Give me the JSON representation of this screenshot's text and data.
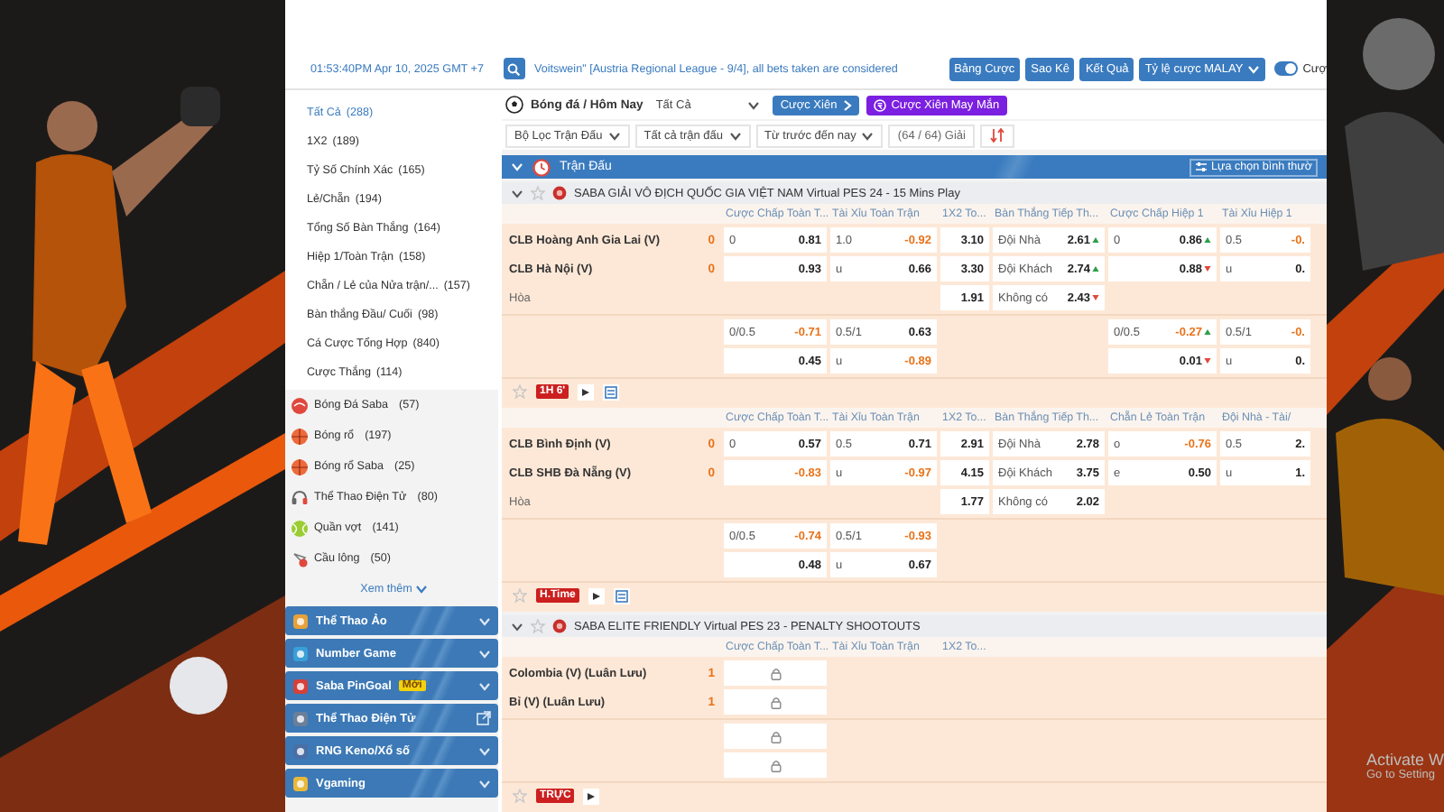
{
  "top_bar": {
    "clock": "01:53:40PM Apr 10, 2025 GMT +7",
    "notice": "Voitswein\" [Austria Regional League - 9/4], all bets taken are considered",
    "buttons": [
      "Bảng Cược",
      "Sao Kê",
      "Kết Quả"
    ],
    "odds_type": "Tỷ lệ cược MALAY",
    "toggle": {
      "label": "Cượ",
      "on": true
    }
  },
  "sidebar": {
    "bet_types": [
      {
        "label": "Tất Cả",
        "count": "(288)",
        "selected": true
      },
      {
        "label": "1X2",
        "count": "(189)",
        "selected": false
      },
      {
        "label": "Tỷ Số Chính Xác",
        "count": "(165)",
        "selected": false
      },
      {
        "label": "Lẻ/Chẵn",
        "count": "(194)",
        "selected": false
      },
      {
        "label": "Tổng Số Bàn Thắng",
        "count": "(164)",
        "selected": false
      },
      {
        "label": "Hiệp 1/Toàn Trận",
        "count": "(158)",
        "selected": false
      },
      {
        "label": "Chẵn / Lẻ của Nửa trận/...",
        "count": "(157)",
        "selected": false
      },
      {
        "label": "Bàn thắng Đầu/ Cuối",
        "count": "(98)",
        "selected": false
      },
      {
        "label": "Cá Cược Tổng Hợp",
        "count": "(840)",
        "selected": false
      },
      {
        "label": "Cược Thắng",
        "count": "(114)",
        "selected": false
      }
    ],
    "sports": [
      {
        "kind": "soccer",
        "label": "Bóng Đá Saba",
        "count": "(57)"
      },
      {
        "kind": "basketball",
        "label": "Bóng rổ",
        "count": "(197)"
      },
      {
        "kind": "basketball",
        "label": "Bóng rổ Saba",
        "count": "(25)"
      },
      {
        "kind": "esports",
        "label": "Thể Thao Điện Tử",
        "count": "(80)"
      },
      {
        "kind": "tennis",
        "label": "Quần vợt",
        "count": "(141)"
      },
      {
        "kind": "badminton",
        "label": "Cầu lông",
        "count": "(50)"
      }
    ],
    "more": "Xem thêm",
    "sections": [
      {
        "label": "Thể Thao Ảo",
        "kind": "expand"
      },
      {
        "label": "Number Game",
        "kind": "expand"
      },
      {
        "label": "Saba PinGoal",
        "badge": "Mới",
        "kind": "expand"
      },
      {
        "label": "Thể Thao Điện Tử",
        "kind": "link"
      },
      {
        "label": "RNG Keno/Xổ số",
        "kind": "expand"
      },
      {
        "label": "Vgaming",
        "kind": "expand"
      }
    ]
  },
  "toolbar": {
    "sport": "Bóng đá / Hôm Nay",
    "filter": "Tất Cả",
    "parlay": "Cược Xiên",
    "lucky_parlay": "Cược Xiên May Mắn"
  },
  "filters": [
    "Bộ Lọc Trận Đấu",
    "Tất cả trận đấu",
    "Từ trước đến nay"
  ],
  "league_count": "(64 / 64) Giải",
  "section": {
    "title": "Trận Đấu",
    "view": "Lựa chọn bình thườ",
    "expanded": true
  },
  "leagues": [
    {
      "name": "SABA GIẢI VÔ ĐỊCH QUỐC GIA VIỆT NAM Virtual PES 24 - 15 Mins Play",
      "expanded": true,
      "favorite": false,
      "matches": [
        {
          "columns": [
            "Cược Chấp Toàn T...",
            "Tài Xỉu Toàn Trận",
            "1X2 To...",
            "Bàn Thắng Tiếp Th...",
            "Cược Chấp Hiệp 1",
            "Tài Xỉu Hiệp 1"
          ],
          "main_rows": [
            {
              "kind": "team",
              "label": "CLB Hoàng Anh Gia Lai (V)",
              "score": "0",
              "cells": [
                {
                  "kind": "odds",
                  "line": "0",
                  "odds": "0.81",
                  "neg": false,
                  "up": false,
                  "down": false
                },
                {
                  "kind": "odds",
                  "line": "1.0",
                  "odds": "-0.92",
                  "neg": true,
                  "up": false,
                  "down": false
                },
                {
                  "kind": "odds",
                  "odds": "3.10",
                  "neg": false,
                  "up": false,
                  "down": false
                },
                {
                  "kind": "odds",
                  "line": "Đội Nhà",
                  "odds": "2.61",
                  "neg": false,
                  "up": true,
                  "down": false
                },
                {
                  "kind": "odds",
                  "line": "0",
                  "odds": "0.86",
                  "neg": false,
                  "up": true,
                  "down": false
                },
                {
                  "kind": "odds",
                  "line": "0.5",
                  "odds": "-0.",
                  "neg": true,
                  "up": false,
                  "down": false
                }
              ]
            },
            {
              "kind": "team",
              "label": "CLB Hà Nội (V)",
              "score": "0",
              "cells": [
                {
                  "kind": "odds",
                  "odds": "0.93",
                  "neg": false,
                  "up": false,
                  "down": false
                },
                {
                  "kind": "odds",
                  "line": "u",
                  "odds": "0.66",
                  "neg": false,
                  "up": false,
                  "down": false
                },
                {
                  "kind": "odds",
                  "odds": "3.30",
                  "neg": false,
                  "up": false,
                  "down": false
                },
                {
                  "kind": "odds",
                  "line": "Đội Khách",
                  "odds": "2.74",
                  "neg": false,
                  "up": true,
                  "down": false
                },
                {
                  "kind": "odds",
                  "odds": "0.88",
                  "neg": false,
                  "up": false,
                  "down": true
                },
                {
                  "kind": "odds",
                  "line": "u",
                  "odds": "0.",
                  "neg": false,
                  "up": false,
                  "down": false
                }
              ]
            },
            {
              "kind": "draw",
              "label": "Hòa",
              "cells": [
                null,
                null,
                {
                  "kind": "odds",
                  "odds": "1.91",
                  "neg": false,
                  "up": false,
                  "down": false
                },
                {
                  "kind": "odds",
                  "line": "Không có",
                  "odds": "2.43",
                  "neg": false,
                  "up": false,
                  "down": true
                },
                null,
                null
              ]
            }
          ],
          "extra_rows": [
            {
              "cells": [
                {
                  "kind": "odds",
                  "line": "0/0.5",
                  "odds": "-0.71",
                  "neg": true,
                  "up": false,
                  "down": false
                },
                {
                  "kind": "odds",
                  "line": "0.5/1",
                  "odds": "0.63",
                  "neg": false,
                  "up": false,
                  "down": false
                },
                null,
                null,
                {
                  "kind": "odds",
                  "line": "0/0.5",
                  "odds": "-0.27",
                  "neg": true,
                  "up": true,
                  "down": false
                },
                {
                  "kind": "odds",
                  "line": "0.5/1",
                  "odds": "-0.",
                  "neg": true,
                  "up": false,
                  "down": false
                }
              ]
            },
            {
              "cells": [
                {
                  "kind": "odds",
                  "odds": "0.45",
                  "neg": false,
                  "up": false,
                  "down": false
                },
                {
                  "kind": "odds",
                  "line": "u",
                  "odds": "-0.89",
                  "neg": true,
                  "up": false,
                  "down": false
                },
                null,
                null,
                {
                  "kind": "odds",
                  "odds": "0.01",
                  "neg": false,
                  "up": false,
                  "down": true
                },
                {
                  "kind": "odds",
                  "line": "u",
                  "odds": "0.",
                  "neg": false,
                  "up": false,
                  "down": false
                }
              ]
            }
          ],
          "footer": {
            "favorite": false,
            "badge": "1H 6'",
            "stats": true
          }
        },
        {
          "columns": [
            "Cược Chấp Toàn T...",
            "Tài Xỉu Toàn Trận",
            "1X2 To...",
            "Bàn Thắng Tiếp Th...",
            "Chẵn Lẻ Toàn Trận",
            "Đội Nhà - Tài/"
          ],
          "main_rows": [
            {
              "kind": "team",
              "label": "CLB Bình Định (V)",
              "score": "0",
              "cells": [
                {
                  "kind": "odds",
                  "line": "0",
                  "odds": "0.57",
                  "neg": false,
                  "up": false,
                  "down": false
                },
                {
                  "kind": "odds",
                  "line": "0.5",
                  "odds": "0.71",
                  "neg": false,
                  "up": false,
                  "down": false
                },
                {
                  "kind": "odds",
                  "odds": "2.91",
                  "neg": false,
                  "up": false,
                  "down": false
                },
                {
                  "kind": "odds",
                  "line": "Đội Nhà",
                  "odds": "2.78",
                  "neg": false,
                  "up": false,
                  "down": false
                },
                {
                  "kind": "odds",
                  "line": "o",
                  "odds": "-0.76",
                  "neg": true,
                  "up": false,
                  "down": false
                },
                {
                  "kind": "odds",
                  "line": "0.5",
                  "odds": "2.",
                  "neg": false,
                  "up": false,
                  "down": false
                }
              ]
            },
            {
              "kind": "team",
              "label": "CLB SHB Đà Nẵng (V)",
              "score": "0",
              "cells": [
                {
                  "kind": "odds",
                  "odds": "-0.83",
                  "neg": true,
                  "up": false,
                  "down": false
                },
                {
                  "kind": "odds",
                  "line": "u",
                  "odds": "-0.97",
                  "neg": true,
                  "up": false,
                  "down": false
                },
                {
                  "kind": "odds",
                  "odds": "4.15",
                  "neg": false,
                  "up": false,
                  "down": false
                },
                {
                  "kind": "odds",
                  "line": "Đội Khách",
                  "odds": "3.75",
                  "neg": false,
                  "up": false,
                  "down": false
                },
                {
                  "kind": "odds",
                  "line": "e",
                  "odds": "0.50",
                  "neg": false,
                  "up": false,
                  "down": false
                },
                {
                  "kind": "odds",
                  "line": "u",
                  "odds": "1.",
                  "neg": false,
                  "up": false,
                  "down": false
                }
              ]
            },
            {
              "kind": "draw",
              "label": "Hòa",
              "cells": [
                null,
                null,
                {
                  "kind": "odds",
                  "odds": "1.77",
                  "neg": false,
                  "up": false,
                  "down": false
                },
                {
                  "kind": "odds",
                  "line": "Không có",
                  "odds": "2.02",
                  "neg": false,
                  "up": false,
                  "down": false
                },
                null,
                null
              ]
            }
          ],
          "extra_rows": [
            {
              "cells": [
                {
                  "kind": "odds",
                  "line": "0/0.5",
                  "odds": "-0.74",
                  "neg": true,
                  "up": false,
                  "down": false
                },
                {
                  "kind": "odds",
                  "line": "0.5/1",
                  "odds": "-0.93",
                  "neg": true,
                  "up": false,
                  "down": false
                },
                null,
                null,
                null,
                null
              ]
            },
            {
              "cells": [
                {
                  "kind": "odds",
                  "odds": "0.48",
                  "neg": false,
                  "up": false,
                  "down": false
                },
                {
                  "kind": "odds",
                  "line": "u",
                  "odds": "0.67",
                  "neg": false,
                  "up": false,
                  "down": false
                },
                null,
                null,
                null,
                null
              ]
            }
          ],
          "footer": {
            "favorite": false,
            "badge": "H.Time",
            "stats": true
          }
        }
      ]
    },
    {
      "name": "SABA ELITE FRIENDLY Virtual PES 23 - PENALTY SHOOTOUTS",
      "expanded": true,
      "favorite": false,
      "matches": [
        {
          "columns": [
            "Cược Chấp Toàn T...",
            "Tài Xỉu Toàn Trận",
            "1X2 To..."
          ],
          "main_rows": [
            {
              "kind": "team",
              "label": "Colombia (V) (Luân Lưu)",
              "score": "1",
              "cells": [
                {
                  "kind": "locked"
                },
                null,
                null
              ]
            },
            {
              "kind": "team",
              "label": "Bỉ (V) (Luân Lưu)",
              "score": "1",
              "cells": [
                {
                  "kind": "locked"
                },
                null,
                null
              ]
            }
          ],
          "extra_rows": [
            {
              "cells": [
                {
                  "kind": "locked"
                },
                null,
                null
              ]
            },
            {
              "cells": [
                {
                  "kind": "locked"
                },
                null,
                null
              ]
            }
          ],
          "footer": {
            "favorite": false,
            "badge": "TRỰC",
            "stats": false
          }
        }
      ]
    }
  ],
  "os_notice": {
    "title": "Activate W",
    "subtitle": "Go to Setting"
  }
}
